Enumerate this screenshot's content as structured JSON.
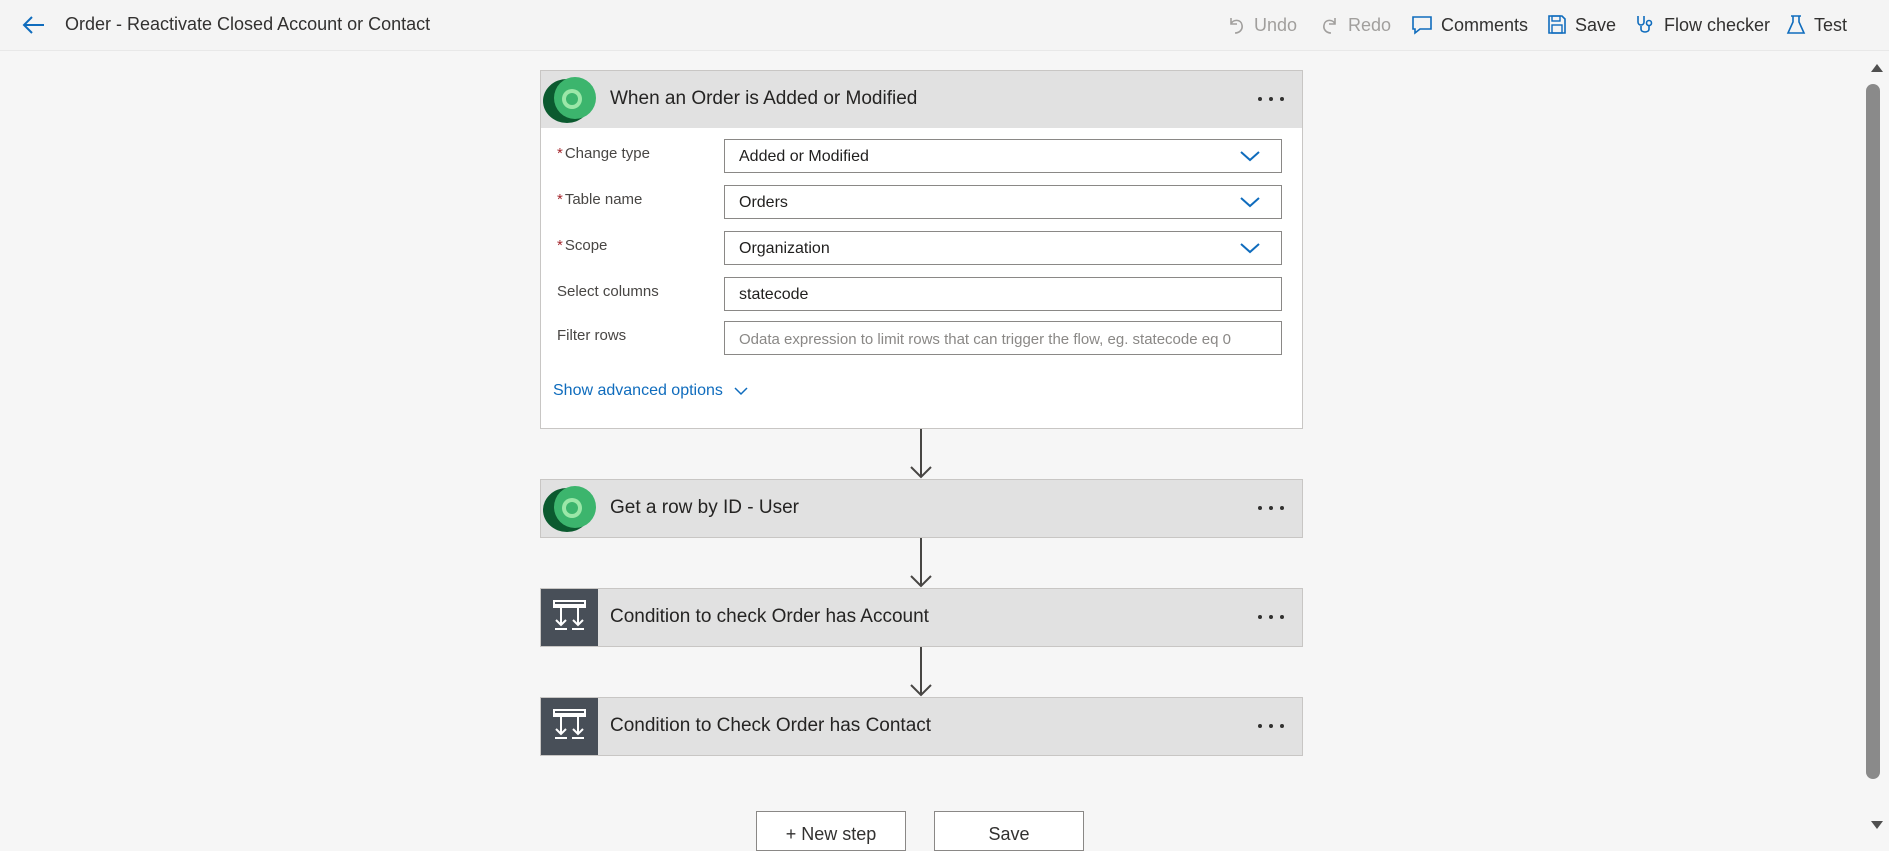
{
  "header": {
    "title": "Order - Reactivate Closed Account or Contact",
    "commands": {
      "undo": "Undo",
      "redo": "Redo",
      "comments": "Comments",
      "save": "Save",
      "flow_checker": "Flow checker",
      "test": "Test"
    }
  },
  "trigger": {
    "title": "When an Order is Added or Modified",
    "icon": "dataverse-icon",
    "fields": {
      "change_type": {
        "label": "Change type",
        "required": true,
        "value": "Added or Modified"
      },
      "table_name": {
        "label": "Table name",
        "required": true,
        "value": "Orders"
      },
      "scope": {
        "label": "Scope",
        "required": true,
        "value": "Organization"
      },
      "select_columns": {
        "label": "Select columns",
        "required": false,
        "value": "statecode"
      },
      "filter_rows": {
        "label": "Filter rows",
        "required": false,
        "value": "",
        "placeholder": "Odata expression to limit rows that can trigger the flow, eg. statecode eq 0"
      }
    },
    "advanced_link": "Show advanced options"
  },
  "steps": [
    {
      "title": "Get a row by ID - User",
      "icon": "dataverse-icon"
    },
    {
      "title": "Condition to check Order has Account",
      "icon": "condition-icon"
    },
    {
      "title": "Condition to Check Order has Contact",
      "icon": "condition-icon"
    }
  ],
  "footer": {
    "new_step": "+ New step",
    "save": "Save"
  },
  "colors": {
    "accent": "#0f6cbd",
    "required": "#a4262c",
    "card_header": "#e1e1e1",
    "condition_icon_bg": "#484f58",
    "dataverse_dark": "#0b5a2f",
    "dataverse_light": "#3cb56d"
  }
}
